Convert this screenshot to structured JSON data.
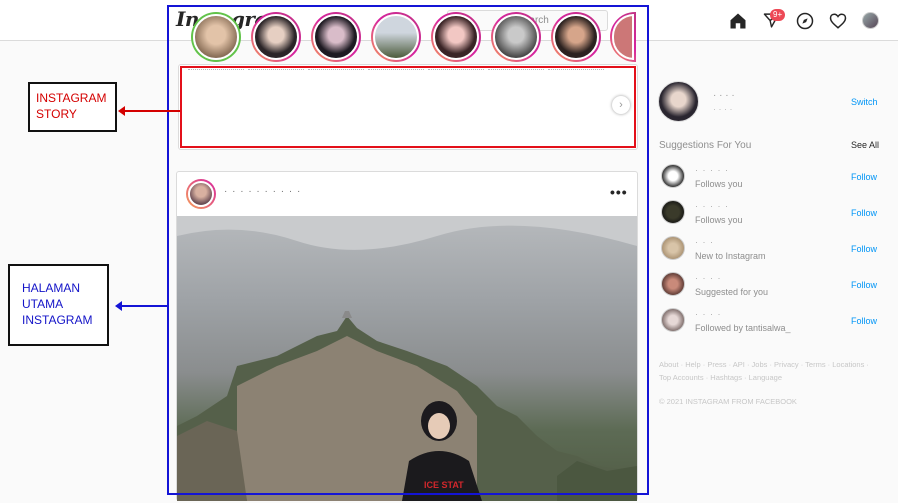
{
  "header": {
    "logo": "Instagram",
    "search_placeholder": "Search",
    "notification_badge": "9+"
  },
  "annotations": {
    "story_label": "INSTAGRAM STORY",
    "home_label": "HALAMAN UTAMA INSTAGRAM",
    "story_color": "#d40000",
    "home_color": "#1414d6"
  },
  "stories": {
    "count": 8
  },
  "post": {
    "more_label": "•••"
  },
  "sidebar": {
    "switch_label": "Switch",
    "suggestions_title": "Suggestions For You",
    "see_all_label": "See All",
    "suggestions": [
      {
        "sub": "Follows you",
        "follow": "Follow"
      },
      {
        "sub": "Follows you",
        "follow": "Follow"
      },
      {
        "sub": "New to Instagram",
        "follow": "Follow"
      },
      {
        "sub": "Suggested for you",
        "follow": "Follow"
      },
      {
        "sub": "Followed by tantisalwa_",
        "follow": "Follow"
      }
    ],
    "footer_links": "About · Help · Press · API · Jobs · Privacy · Terms · Locations · Top Accounts · Hashtags · Language",
    "copyright": "© 2021 INSTAGRAM FROM FACEBOOK"
  },
  "colors": {
    "link": "#0095f6",
    "badge": "#ed4956"
  }
}
